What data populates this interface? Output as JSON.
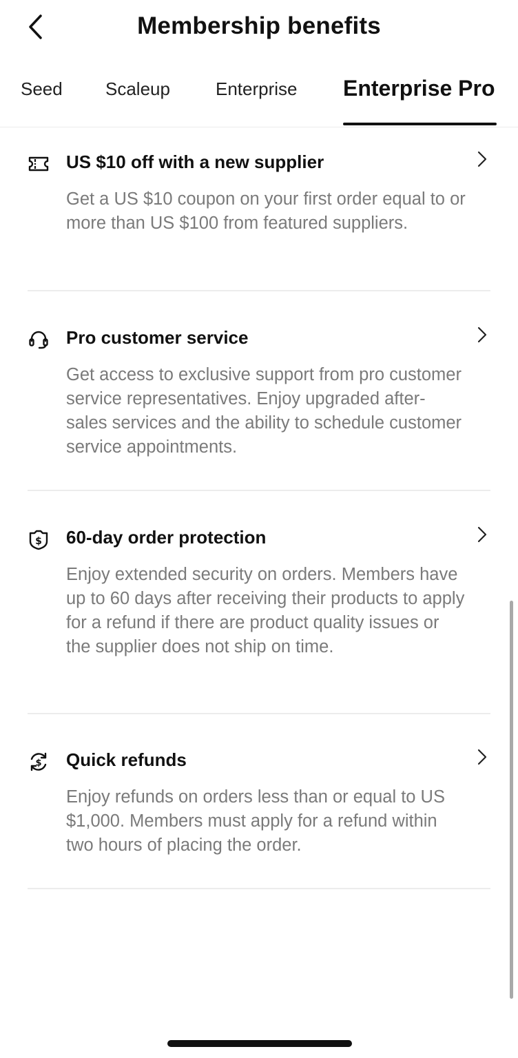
{
  "header": {
    "title": "Membership benefits",
    "back_icon": "chevron-left-icon"
  },
  "tabs": [
    {
      "label": "Seed",
      "active": false
    },
    {
      "label": "Scaleup",
      "active": false
    },
    {
      "label": "Enterprise",
      "active": false
    },
    {
      "label": "Enterprise Pro",
      "active": true
    }
  ],
  "benefits": [
    {
      "icon": "coupon-ticket-icon",
      "title": "US $10 off with a new supplier",
      "description": "Get a US $10 coupon on your first order equal to or more than US $100 from featured suppliers."
    },
    {
      "icon": "headset-icon",
      "title": "Pro customer service",
      "description": "Get access to exclusive support from pro customer service representatives. Enjoy upgraded after-sales services and the ability to schedule customer service appointments."
    },
    {
      "icon": "dollar-shield-icon",
      "title": "60-day order protection",
      "description": "Enjoy extended security on orders. Members have up to 60 days after receiving their products to apply for a refund if there are product quality issues or the supplier does not ship on time."
    },
    {
      "icon": "refund-cycle-icon",
      "title": "Quick refunds",
      "description": "Enjoy refunds on orders less than or equal to US $1,000. Members must apply for a refund within two hours of placing the order."
    }
  ],
  "colors": {
    "title_text": "#111111",
    "description_text": "#7a7a7a",
    "divider": "#ececec",
    "active_tab_underline": "#111111"
  }
}
